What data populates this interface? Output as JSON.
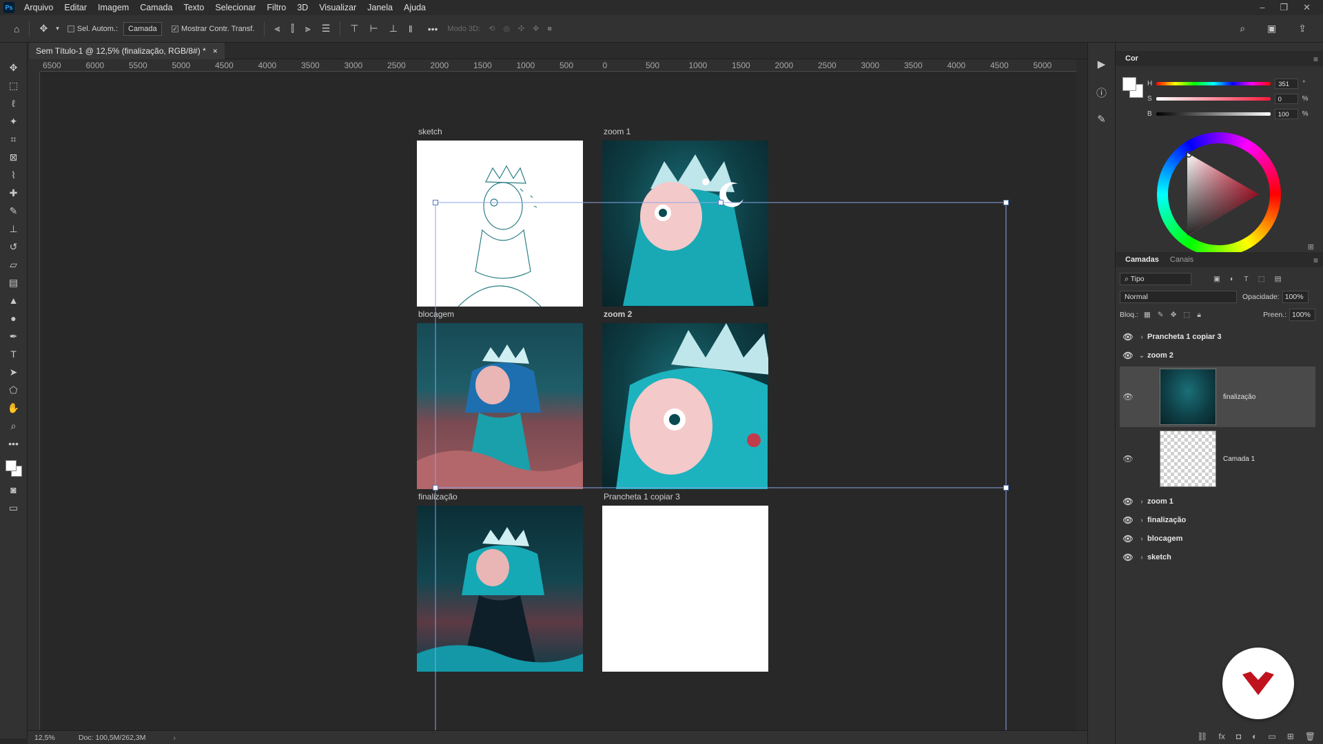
{
  "menu": [
    "Arquivo",
    "Editar",
    "Imagem",
    "Camada",
    "Texto",
    "Selecionar",
    "Filtro",
    "3D",
    "Visualizar",
    "Janela",
    "Ajuda"
  ],
  "app_logo": "Ps",
  "options": {
    "auto_select_label": "Sel. Autom.:",
    "auto_select_value": "Camada",
    "show_transform_label": "Mostrar Contr. Transf.",
    "mode3d_label": "Modo 3D:"
  },
  "document": {
    "tab_title": "Sem Título-1 @ 12,5% (finalização, RGB/8#) *",
    "close": "×"
  },
  "ruler_h": [
    "6500",
    "6000",
    "5500",
    "5000",
    "4500",
    "4000",
    "3500",
    "3000",
    "2500",
    "2000",
    "1500",
    "1000",
    "500",
    "0",
    "500",
    "1000",
    "1500",
    "2000",
    "2500",
    "3000",
    "3500",
    "4000",
    "4500",
    "5000"
  ],
  "artboards": {
    "sketch": "sketch",
    "zoom1": "zoom 1",
    "blocagem": "blocagem",
    "zoom2": "zoom 2",
    "finalizacao": "finalização",
    "prancheta": "Prancheta 1 copiar 3"
  },
  "status": {
    "zoom": "12,5%",
    "doc": "Doc: 100,5M/262,3M"
  },
  "color_panel": {
    "title": "Cor",
    "h_label": "H",
    "h_value": "351",
    "h_unit": "°",
    "s_label": "S",
    "s_value": "0",
    "s_unit": "%",
    "b_label": "B",
    "b_value": "100",
    "b_unit": "%",
    "accent": "#ff1a3c"
  },
  "layers_panel": {
    "tab_layers": "Camadas",
    "tab_channels": "Canais",
    "filter_kind": "Tipo",
    "blend_mode": "Normal",
    "opacity_label": "Opacidade:",
    "opacity_value": "100%",
    "lock_label": "Bloq.:",
    "fill_label": "Preen.:",
    "fill_value": "100%",
    "layers": [
      {
        "name": "Prancheta 1 copiar 3"
      },
      {
        "name": "zoom 2"
      },
      {
        "name": "finalização"
      },
      {
        "name": "Camada 1"
      },
      {
        "name": "zoom 1"
      },
      {
        "name": "finalização"
      },
      {
        "name": "blocagem"
      },
      {
        "name": "sketch"
      }
    ]
  }
}
